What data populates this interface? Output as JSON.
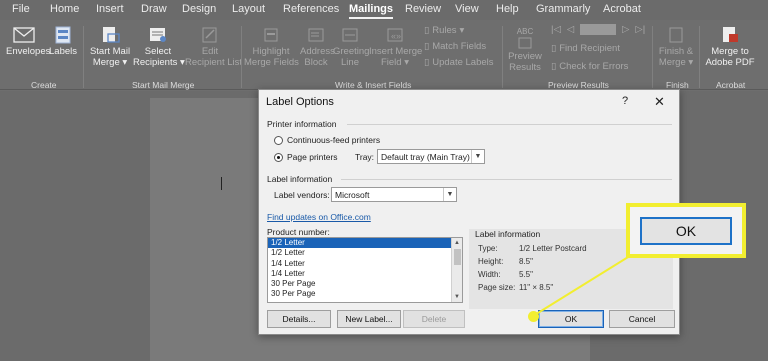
{
  "ribbon_tabs": [
    "File",
    "Home",
    "Insert",
    "Draw",
    "Design",
    "Layout",
    "References",
    "Mailings",
    "Review",
    "View",
    "Help",
    "Grammarly",
    "Acrobat"
  ],
  "active_tab": "Mailings",
  "ribbon": {
    "create": {
      "envelopes": "Envelopes",
      "labels": "Labels",
      "group": "Create"
    },
    "start_mail_merge": {
      "start_1": "Start Mail",
      "start_2": "Merge",
      "select_1": "Select",
      "select_2": "Recipients",
      "edit_1": "Edit",
      "edit_2": "Recipient List",
      "group": "Start Mail Merge"
    },
    "write_insert": {
      "highlight_1": "Highlight",
      "highlight_2": "Merge Fields",
      "address_1": "Address",
      "address_2": "Block",
      "greeting_1": "Greeting",
      "greeting_2": "Line",
      "insert_1": "Insert Merge",
      "insert_2": "Field",
      "rules": "Rules",
      "match": "Match Fields",
      "update": "Update Labels",
      "group": "Write & Insert Fields"
    },
    "preview": {
      "preview_1": "Preview",
      "preview_2": "Results",
      "abc": "ABC",
      "find": "Find Recipient",
      "check": "Check for Errors",
      "group": "Preview Results"
    },
    "finish": {
      "finish_1": "Finish &",
      "finish_2": "Merge",
      "group": "Finish"
    },
    "acrobat": {
      "merge_1": "Merge to",
      "merge_2": "Adobe PDF",
      "group": "Acrobat"
    }
  },
  "dialog": {
    "title": "Label Options",
    "help": "?",
    "close": "✕",
    "printer_info_heading": "Printer information",
    "continuous_feed": "Continuous-feed printers",
    "page_printers": "Page printers",
    "tray_label": "Tray:",
    "tray_value": "Default tray (Main Tray)",
    "label_info_heading": "Label information",
    "label_vendors_label": "Label vendors:",
    "label_vendors_value": "Microsoft",
    "find_updates_link": "Find updates on Office.com",
    "product_number_label": "Product number:",
    "products": [
      "1/2 Letter",
      "1/2 Letter",
      "1/4 Letter",
      "1/4 Letter",
      "30 Per Page",
      "30 Per Page"
    ],
    "selected_product_index": 0,
    "right_info": {
      "heading": "Label information",
      "type_label": "Type:",
      "type_value": "1/2 Letter Postcard",
      "height_label": "Height:",
      "height_value": "8.5\"",
      "width_label": "Width:",
      "width_value": "5.5\"",
      "page_size_label": "Page size:",
      "page_size_value": "11\" × 8.5\""
    },
    "buttons": {
      "details": "Details...",
      "new_label": "New Label...",
      "delete": "Delete",
      "ok": "OK",
      "cancel": "Cancel"
    }
  },
  "callout": {
    "ok_label": "OK",
    "highlight_color": "#f2ee30",
    "focus_color": "#1e72c8"
  }
}
